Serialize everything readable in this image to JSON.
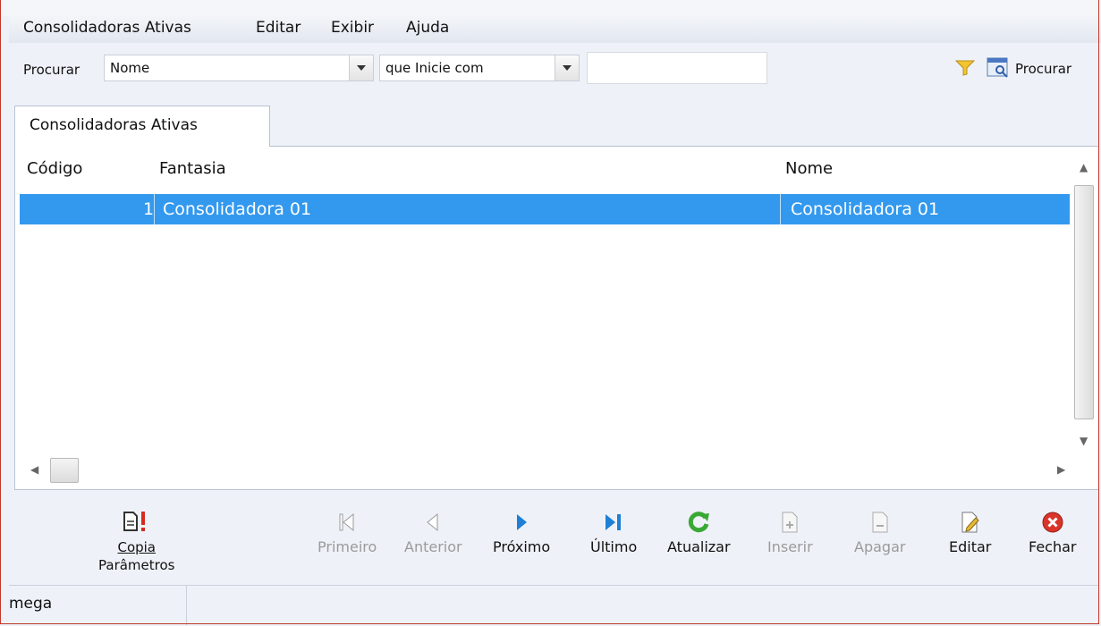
{
  "menubar": {
    "items": [
      "Consolidadoras Ativas",
      "Editar",
      "Exibir",
      "Ajuda"
    ]
  },
  "search": {
    "label": "Procurar",
    "field_value": "Nome",
    "operator_value": "que Inicie com",
    "input_value": "",
    "button_label": "Procurar"
  },
  "tab": {
    "label": "Consolidadoras Ativas"
  },
  "table": {
    "columns": [
      "Código",
      "Fantasia",
      "Nome"
    ],
    "rows": [
      {
        "codigo": "1",
        "fantasia": "Consolidadora 01",
        "nome": "Consolidadora 01"
      }
    ]
  },
  "toolbar": {
    "copia_line1": "Copia",
    "copia_line2": "Parâmetros",
    "primeiro": "Primeiro",
    "anterior": "Anterior",
    "proximo": "Próximo",
    "ultimo": "Último",
    "atualizar": "Atualizar",
    "inserir": "Inserir",
    "apagar": "Apagar",
    "editar": "Editar",
    "fechar": "Fechar"
  },
  "status": {
    "user": "mega"
  },
  "colors": {
    "selection": "#3399ee",
    "nav_blue": "#1e7fd6",
    "refresh_green": "#3aa835",
    "close_red": "#d9342b"
  }
}
